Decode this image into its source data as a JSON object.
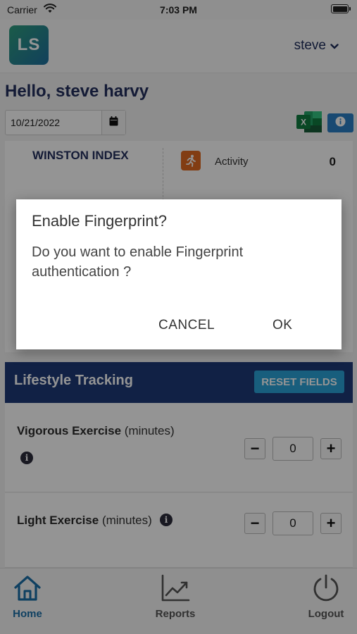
{
  "status_bar": {
    "carrier": "Carrier",
    "time": "7:03 PM",
    "icons": [
      "wifi-icon",
      "battery-icon"
    ]
  },
  "header": {
    "logo_text": "LS",
    "username": "steve",
    "dropdown_icon": "chevron-down-icon"
  },
  "greeting": "Hello, steve harvy",
  "date_picker": {
    "value": "10/21/2022",
    "icon": "calendar-icon"
  },
  "toolbar": {
    "export_icon": "excel-icon",
    "info_icon": "info-icon"
  },
  "index_card": {
    "title": "WINSTON INDEX",
    "activity_label": "Activity",
    "activity_value": "0",
    "activity_icon": "running-person-icon"
  },
  "lifestyle": {
    "title": "Lifestyle Tracking",
    "reset_label": "RESET FIELDS",
    "rows": [
      {
        "name": "Vigorous Exercise",
        "unit": "(minutes)",
        "value": "0"
      },
      {
        "name": "Light Exercise",
        "unit": "(minutes)",
        "value": "0"
      }
    ],
    "minus_symbol": "−",
    "plus_symbol": "+",
    "info_symbol": "i"
  },
  "tabs": [
    {
      "label": "Home",
      "icon": "home-icon",
      "active": true
    },
    {
      "label": "Reports",
      "icon": "chart-icon",
      "active": false
    },
    {
      "label": "Logout",
      "icon": "power-icon",
      "active": false
    }
  ],
  "dialog": {
    "title": "Enable Fingerprint?",
    "message": "Do you want to enable Fingerprint authentication ?",
    "cancel_label": "CANCEL",
    "ok_label": "OK"
  },
  "colors": {
    "primary_navy": "#1e3a78",
    "accent_blue": "#2aa3d8",
    "activity_orange": "#e06a22",
    "active_tab": "#1b6ea8"
  }
}
